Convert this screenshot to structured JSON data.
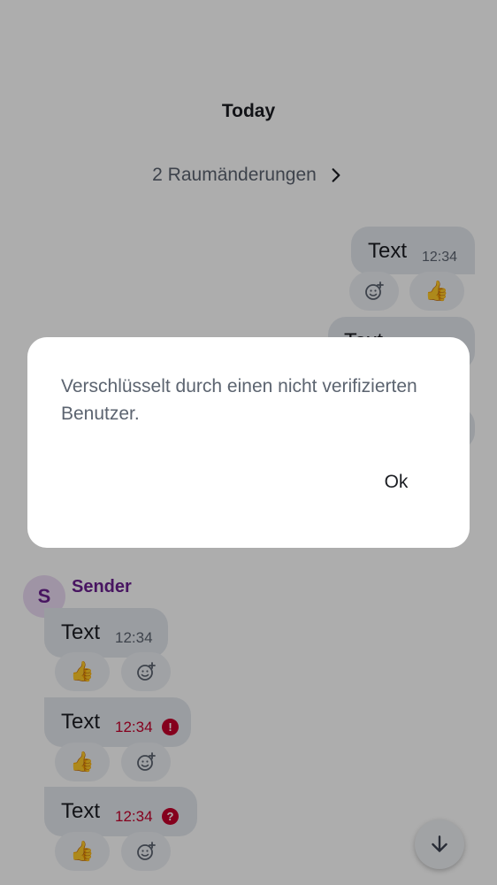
{
  "timeline": {
    "day_separator": "Today",
    "room_changes": "2 Raumänderungen",
    "outgoing": [
      {
        "text": "Text",
        "time": "12:34",
        "reaction": "👍"
      },
      {
        "text": "Text"
      }
    ],
    "sender_name": "Sender",
    "sender_initial": "S",
    "incoming": [
      {
        "text": "Text",
        "time": "12:34",
        "reaction": "👍",
        "status": ""
      },
      {
        "text": "Text",
        "time": "12:34",
        "reaction": "👍",
        "status": "!"
      },
      {
        "text": "Text",
        "time": "12:34",
        "reaction": "👍",
        "status": "?"
      }
    ]
  },
  "dialog": {
    "message": "Verschlüsselt durch einen nicht verifizierten Benutzer.",
    "ok_label": "Ok"
  },
  "colors": {
    "accent": "#6b1f8f",
    "error": "#c4002b",
    "bubble": "#e4e8ee"
  },
  "icons": {
    "add_reaction": "add-reaction-icon",
    "chevron": "chevron-right-icon",
    "scroll_down": "arrow-down-icon"
  }
}
